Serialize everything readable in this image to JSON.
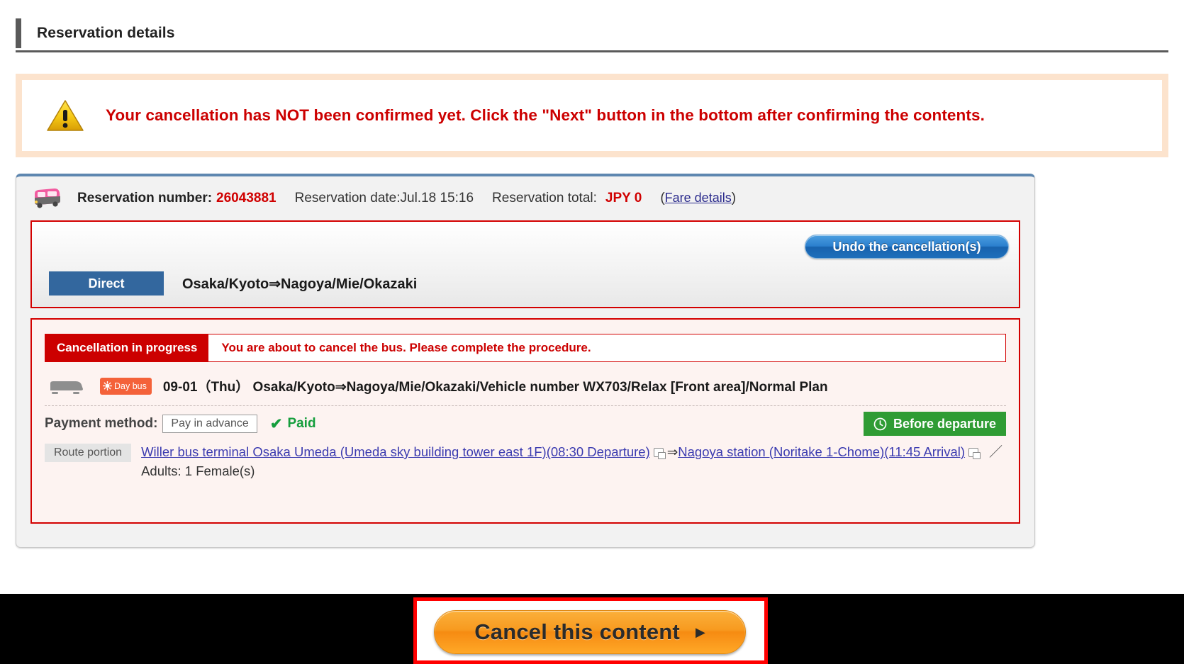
{
  "header": {
    "title": "Reservation details"
  },
  "warning": {
    "icon": "warning-triangle-icon",
    "text": "Your cancellation has NOT been confirmed yet. Click the \"Next\" button in the bottom after confirming the contents."
  },
  "reservation": {
    "bus_icon": "pink-bus-icon",
    "number_label": "Reservation number:",
    "number": "26043881",
    "date_label": "Reservation date:Jul.18 15:16",
    "total_label": "Reservation total:",
    "total_value": "JPY 0",
    "fare_open": "(",
    "fare_link": "Fare details",
    "fare_close": ")",
    "undo_button": "Undo the cancellation(s)",
    "direct_badge": "Direct",
    "direct_route": "Osaka/Kyoto⇒Nagoya/Mie/Okazaki",
    "cancellation": {
      "status_label": "Cancellation in progress",
      "status_message": "You are about to cancel the bus. Please complete the procedure.",
      "bus_icon": "grey-bus-icon",
      "day_badge": "Day bus",
      "day_badge_icon": "sun-icon",
      "trip_text": "09-01（Thu） Osaka/Kyoto⇒Nagoya/Mie/Okazaki/Vehicle number WX703/Relax [Front area]/Normal Plan",
      "payment_label": "Payment method:",
      "payment_value": "Pay in advance",
      "paid_check": "✔",
      "paid_label": "Paid",
      "before_departure": "Before departure",
      "before_departure_icon": "clock-icon",
      "route_chip": "Route portion",
      "departure_link": "Willer bus terminal Osaka Umeda (Umeda sky building tower east 1F)(08:30 Departure)",
      "route_arrow": "⇒",
      "arrival_link": "Nagoya station (Noritake 1-Chome)(11:45 Arrival)",
      "trailing_slash": "／",
      "passengers": "Adults: 1 Female(s)"
    }
  },
  "footer": {
    "cta_label": "Cancel this content",
    "cta_arrow": "▶"
  },
  "colors": {
    "alert_red": "#cc0000",
    "brand_blue": "#33679e",
    "paid_green": "#159e3d",
    "badge_green": "#2f9c34",
    "day_orange": "#f4623a",
    "cta_orange": "#f79a1f",
    "highlight_red": "#ff0000"
  }
}
